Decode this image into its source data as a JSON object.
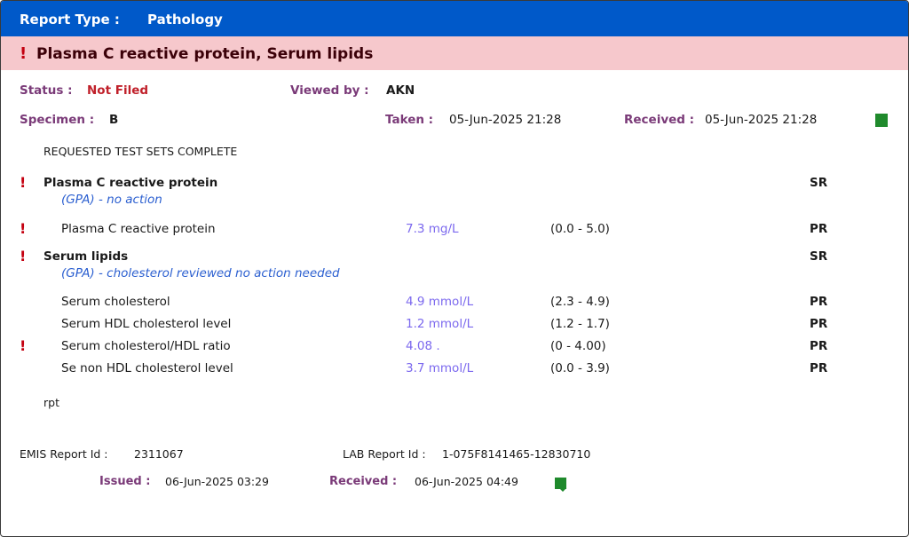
{
  "header": {
    "report_type_label": "Report Type :",
    "report_type_value": "Pathology"
  },
  "alert": {
    "icon": "exclamation-icon",
    "title": "Plasma C reactive protein, Serum lipids"
  },
  "status": {
    "label": "Status :",
    "value": "Not Filed",
    "value_color": "#c0202a"
  },
  "viewed_by": {
    "label": "Viewed by :",
    "value": "AKN"
  },
  "specimen": {
    "label": "Specimen :",
    "value": "B"
  },
  "taken": {
    "label": "Taken :",
    "value": "05-Jun-2025 21:28"
  },
  "received": {
    "label": "Received :",
    "value": "05-Jun-2025 21:28"
  },
  "requested_note": "REQUESTED TEST SETS COMPLETE",
  "groups": [
    {
      "name": "Plasma C reactive protein",
      "comment": "(GPA) - no action",
      "code": "SR",
      "abnormal": true,
      "tests": [
        {
          "name": "Plasma C reactive protein",
          "result": "7.3 mg/L",
          "range": "(0.0 - 5.0)",
          "code": "PR",
          "abnormal": true
        }
      ]
    },
    {
      "name": "Serum lipids",
      "comment": "(GPA) - cholesterol reviewed no action needed",
      "code": "SR",
      "abnormal": true,
      "tests": [
        {
          "name": "Serum cholesterol",
          "result": "4.9 mmol/L",
          "range": "(2.3 - 4.9)",
          "code": "PR",
          "abnormal": false
        },
        {
          "name": "Serum HDL cholesterol level",
          "result": "1.2 mmol/L",
          "range": "(1.2 - 1.7)",
          "code": "PR",
          "abnormal": false
        },
        {
          "name": "Serum cholesterol/HDL ratio",
          "result": "4.08 .",
          "range": "(0 - 4.00)",
          "code": "PR",
          "abnormal": true
        },
        {
          "name": "Se non HDL cholesterol level",
          "result": "3.7 mmol/L",
          "range": "(0.0 - 3.9)",
          "code": "PR",
          "abnormal": false
        }
      ]
    }
  ],
  "footer_note": "rpt",
  "footer": {
    "emis_label": "EMIS Report Id :",
    "emis_value": "2311067",
    "lab_label": "LAB Report Id :",
    "lab_value": "1-075F8141465-12830710",
    "issued_label": "Issued :",
    "issued_value": "06-Jun-2025 03:29",
    "received_label": "Received :",
    "received_value": "06-Jun-2025 04:49"
  },
  "colors": {
    "header_bg": "#0059c9",
    "alert_bg": "#f6c8cc",
    "label": "#7a3a78",
    "result": "#7b68ee",
    "comment": "#2b5fd0",
    "status_marker": "#1f8a2c"
  }
}
